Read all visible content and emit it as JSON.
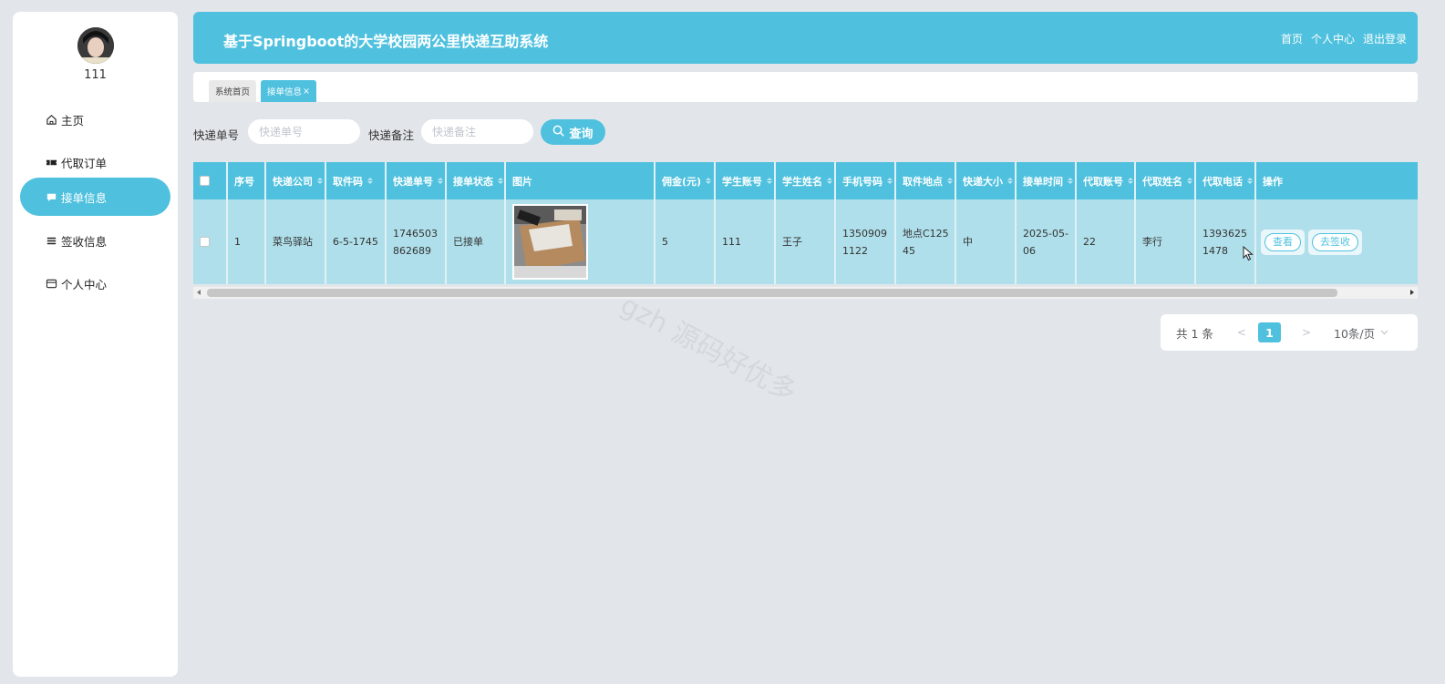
{
  "sidebar": {
    "username": "111",
    "items": [
      {
        "label": "主页",
        "icon": "home-icon"
      },
      {
        "label": "代取订单",
        "icon": "ticket-icon"
      },
      {
        "label": "接单信息",
        "icon": "message-icon",
        "active": true
      },
      {
        "label": "签收信息",
        "icon": "list-icon"
      },
      {
        "label": "个人中心",
        "icon": "card-icon"
      }
    ]
  },
  "header": {
    "title": "基于Springboot的大学校园两公里快递互助系统",
    "links": [
      "首页",
      "个人中心",
      "退出登录"
    ]
  },
  "tabs": {
    "home": "系统首页",
    "current": "接单信息",
    "close_icon": "×"
  },
  "search": {
    "field1_label": "快递单号",
    "field1_placeholder": "快递单号",
    "field2_label": "快递备注",
    "field2_placeholder": "快递备注",
    "button_label": "查询"
  },
  "table": {
    "headers": [
      "序号",
      "快递公司",
      "取件码",
      "快递单号",
      "接单状态",
      "图片",
      "佣金(元)",
      "学生账号",
      "学生姓名",
      "手机号码",
      "取件地点",
      "快递大小",
      "接单时间",
      "代取账号",
      "代取姓名",
      "代取电话",
      "操作"
    ],
    "rows": [
      {
        "index": "1",
        "company": "菜鸟驿站",
        "pickup_code": "6-5-1745",
        "tracking_no": "1746503862689",
        "status": "已接单",
        "commission": "5",
        "student_account": "111",
        "student_name": "王子",
        "phone": "13509091122",
        "location": "地点C12545",
        "size": "中",
        "time": "2025-05-06",
        "agent_account": "22",
        "agent_name": "李行",
        "agent_phone": "13936251478",
        "actions": [
          "查看",
          "去签收"
        ]
      }
    ]
  },
  "pagination": {
    "total": "共 1 条",
    "prev": "<",
    "current": "1",
    "next": ">",
    "page_size": "10条/页"
  },
  "watermark": "gzh 源码好优多",
  "colors": {
    "primary": "#4fc1de",
    "row": "#afdfea",
    "background": "#e2e6ea"
  }
}
